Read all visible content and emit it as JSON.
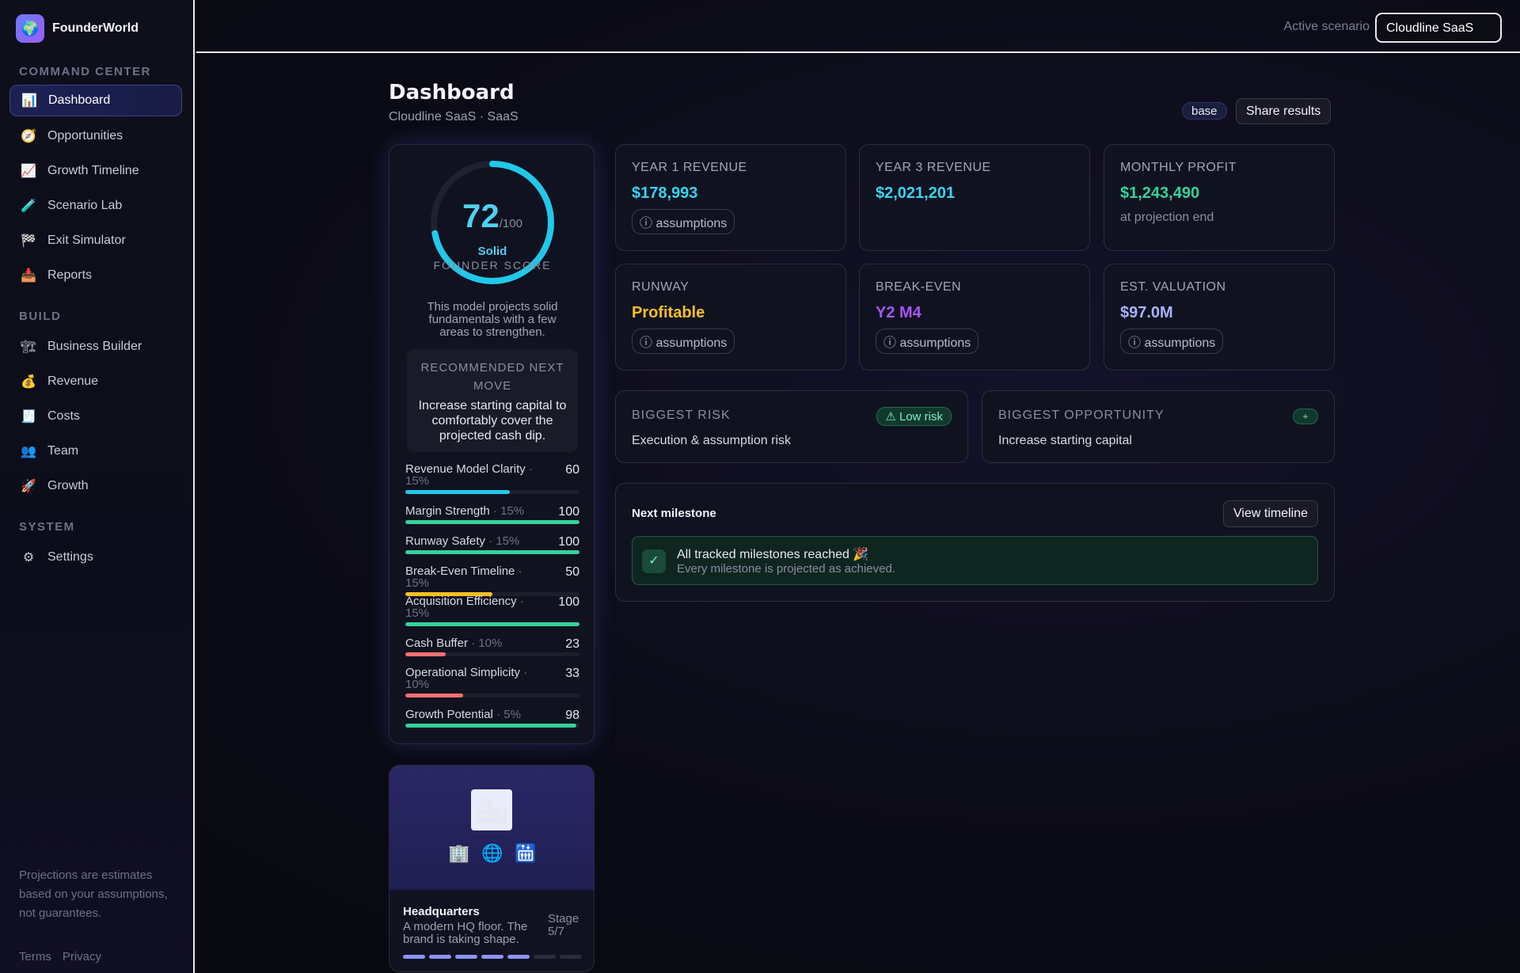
{
  "brand": {
    "name": "FounderWorld",
    "logo_icon": "🌍"
  },
  "sidebar": {
    "sections": [
      {
        "title": "Command Center"
      },
      {
        "title": "Build"
      },
      {
        "title": "System"
      }
    ],
    "items": [
      {
        "label": "Dashboard",
        "icon": "📊",
        "icon_name": "bar-chart-icon",
        "active": true
      },
      {
        "label": "Opportunities",
        "icon": "🧭",
        "icon_name": "compass-icon"
      },
      {
        "label": "Growth Timeline",
        "icon": "📈",
        "icon_name": "trend-up-icon"
      },
      {
        "label": "Scenario Lab",
        "icon": "🧪",
        "icon_name": "test-tube-icon"
      },
      {
        "label": "Exit Simulator",
        "icon": "🏁",
        "icon_name": "checkered-flag-icon"
      },
      {
        "label": "Reports",
        "icon": "📥",
        "icon_name": "inbox-tray-icon"
      },
      {
        "label": "Business Builder",
        "icon": "🏗",
        "icon_name": "construction-icon"
      },
      {
        "label": "Revenue",
        "icon": "💰",
        "icon_name": "money-bag-icon"
      },
      {
        "label": "Costs",
        "icon": "🧾",
        "icon_name": "receipt-icon"
      },
      {
        "label": "Team",
        "icon": "👥",
        "icon_name": "people-icon"
      },
      {
        "label": "Growth",
        "icon": "🚀",
        "icon_name": "rocket-icon"
      },
      {
        "label": "Settings",
        "icon": "⚙",
        "icon_name": "gear-icon"
      }
    ],
    "footer_note": "Projections are estimates based on your assumptions, not guarantees.",
    "links": {
      "terms": "Terms",
      "privacy": "Privacy"
    }
  },
  "topbar": {
    "scenario_label": "Active scenario",
    "scenario_value": "Cloudline SaaS"
  },
  "header": {
    "title": "Dashboard",
    "subtitle": "Cloudline SaaS · SaaS",
    "badge": "base",
    "share_label": "Share results"
  },
  "score": {
    "value": "72",
    "value_num": 72,
    "denominator": "/100",
    "grade": "Solid",
    "caption": "FOUNDER SCORE",
    "description": "This model projects solid fundamentals with a few areas to strengthen.",
    "recommendation_title": "RECOMMENDED NEXT MOVE",
    "recommendation_text": "Increase starting capital to comfortably cover the projected cash dip.",
    "accent": "#22c8ea",
    "metrics": [
      {
        "label": "Revenue Model Clarity",
        "weight": "· 15%",
        "value": "60",
        "pct": 60,
        "color": "#22c8ea"
      },
      {
        "label": "Margin Strength",
        "weight": "· 15%",
        "value": "100",
        "pct": 100,
        "color": "#34d399"
      },
      {
        "label": "Runway Safety",
        "weight": "· 15%",
        "value": "100",
        "pct": 100,
        "color": "#34d399"
      },
      {
        "label": "Break-Even Timeline",
        "weight": "· 15%",
        "value": "50",
        "pct": 50,
        "color": "#fbbf24"
      },
      {
        "label": "Acquisition Efficiency",
        "weight": "· 15%",
        "value": "100",
        "pct": 100,
        "color": "#34d399"
      },
      {
        "label": "Cash Buffer",
        "weight": "· 10%",
        "value": "23",
        "pct": 23,
        "color": "#f87171"
      },
      {
        "label": "Operational Simplicity",
        "weight": "· 10%",
        "value": "33",
        "pct": 33,
        "color": "#f87171"
      },
      {
        "label": "Growth Potential",
        "weight": "· 5%",
        "value": "98",
        "pct": 98,
        "color": "#34d399"
      }
    ]
  },
  "hq": {
    "title": "Headquarters",
    "description": "A modern HQ floor. The brand is taking shape.",
    "stage": "Stage 5/7",
    "stage_current": 5,
    "stage_total": 7,
    "icons": {
      "main": "🏙",
      "a": "🏢",
      "b": "🌐",
      "c": "🛗"
    }
  },
  "kpis": [
    {
      "label": "Year 1 Revenue",
      "value": "$178,993",
      "chip": "ⓘ assumptions",
      "color": "#38d4f0"
    },
    {
      "label": "Year 3 Revenue",
      "value": "$2,021,201",
      "color": "#38d4f0"
    },
    {
      "label": "Monthly Profit",
      "value": "$1,243,490",
      "note": "at projection end",
      "color": "#34d399"
    },
    {
      "label": "Runway",
      "value": "Profitable",
      "chip": "ⓘ assumptions",
      "color": "#fbbf24"
    },
    {
      "label": "Break-Even",
      "value": "Y2 M4",
      "chip": "ⓘ assumptions",
      "color": "#a855f7"
    },
    {
      "label": "Est. Valuation",
      "value": "$97.0M",
      "chip": "ⓘ assumptions",
      "color": "#a5b4fc"
    }
  ],
  "risk": {
    "label": "Biggest Risk",
    "value": "Execution & assumption risk",
    "pill": "⚠ Low risk"
  },
  "opportunity": {
    "label": "Biggest Opportunity",
    "value": "Increase starting capital",
    "pill": "+"
  },
  "milestone": {
    "title": "Next milestone",
    "button": "View timeline",
    "check": "✓",
    "main": "All tracked milestones reached 🎉",
    "sub": "Every milestone is projected as achieved."
  }
}
